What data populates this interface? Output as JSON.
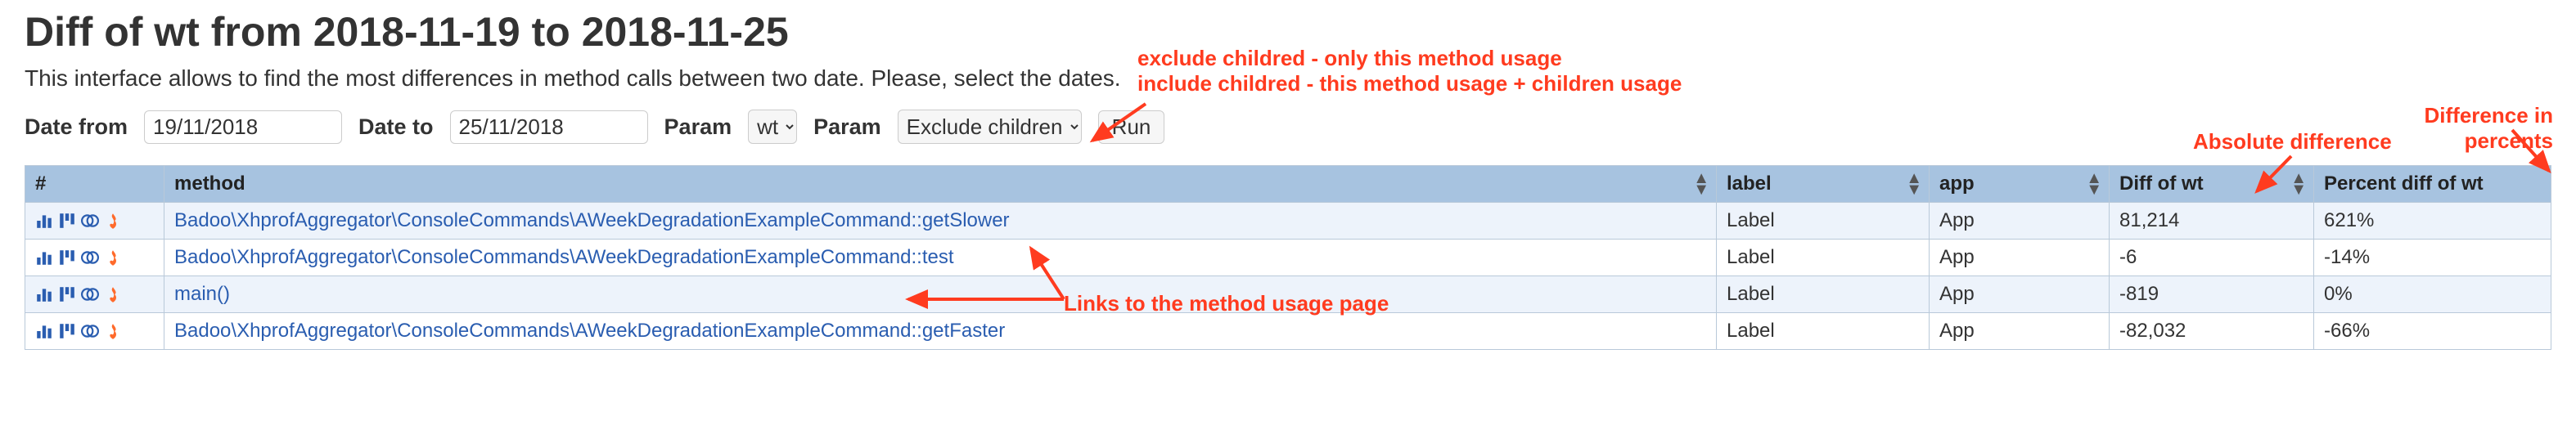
{
  "title": "Diff of wt from 2018-11-19 to 2018-11-25",
  "intro": "This interface allows to find the most differences in method calls between two date. Please, select the dates.",
  "filters": {
    "date_from_label": "Date from",
    "date_from_value": "19/11/2018",
    "date_to_label": "Date to",
    "date_to_value": "25/11/2018",
    "param1_label": "Param",
    "param1_value": "wt",
    "param2_label": "Param",
    "param2_value": "Exclude children",
    "run_label": "Run"
  },
  "columns": {
    "actions": "#",
    "method": "method",
    "label": "label",
    "app": "app",
    "diff": "Diff of wt",
    "pct": "Percent diff of wt"
  },
  "rows": [
    {
      "method": "Badoo\\XhprofAggregator\\ConsoleCommands\\AWeekDegradationExampleCommand::getSlower",
      "label": "Label",
      "app": "App",
      "diff": "81,214",
      "pct": "621%"
    },
    {
      "method": "Badoo\\XhprofAggregator\\ConsoleCommands\\AWeekDegradationExampleCommand::test",
      "label": "Label",
      "app": "App",
      "diff": "-6",
      "pct": "-14%"
    },
    {
      "method": "main()",
      "label": "Label",
      "app": "App",
      "diff": "-819",
      "pct": "0%"
    },
    {
      "method": "Badoo\\XhprofAggregator\\ConsoleCommands\\AWeekDegradationExampleCommand::getFaster",
      "label": "Label",
      "app": "App",
      "diff": "-82,032",
      "pct": "-66%"
    }
  ],
  "annotations": {
    "children_line1": "exclude childred - only this method usage",
    "children_line2": "include childred - this method usage + children usage",
    "abs_diff": "Absolute difference",
    "pct_diff": "Difference in percents",
    "links": "Links to the method usage page"
  }
}
